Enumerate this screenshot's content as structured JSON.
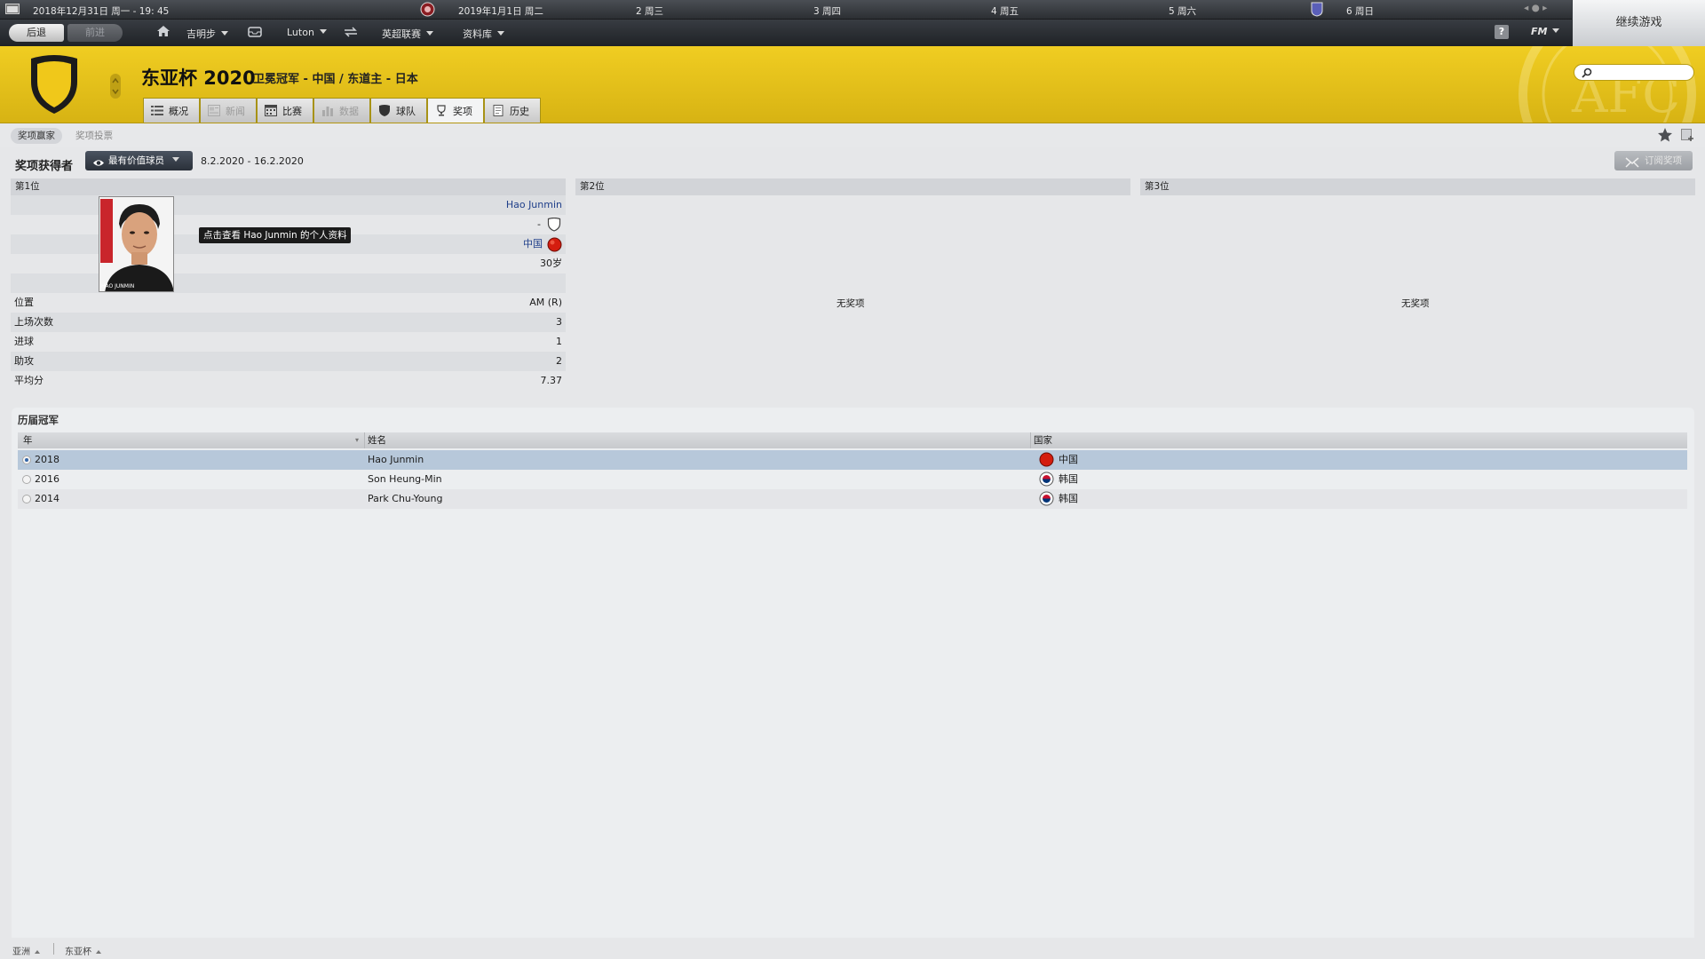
{
  "calendar": {
    "current_date": "2018年12月31日 周一 - 19: 45",
    "days": [
      "2019年1月1日 周二",
      "2 周三",
      "3 周四",
      "4 周五",
      "5 周六",
      "6 周日"
    ]
  },
  "nav": {
    "back": "后退",
    "forward": "前进",
    "manager": "吉明步",
    "club": "Luton",
    "league": "英超联赛",
    "database": "资料库",
    "help": "?",
    "fm_menu": "FM",
    "continue": "继续游戏"
  },
  "header": {
    "title": "东亚杯 2020",
    "subtitle": "卫冕冠军 - 中国 / 东道主 - 日本",
    "tabs": [
      {
        "label": "概况",
        "icon": "list-icon",
        "state": "normal"
      },
      {
        "label": "新闻",
        "icon": "newspaper-icon",
        "state": "disabled"
      },
      {
        "label": "比赛",
        "icon": "calendar-icon",
        "state": "normal"
      },
      {
        "label": "数据",
        "icon": "stats-icon",
        "state": "disabled"
      },
      {
        "label": "球队",
        "icon": "shield-icon",
        "state": "normal"
      },
      {
        "label": "奖项",
        "icon": "trophy-icon",
        "state": "active"
      },
      {
        "label": "历史",
        "icon": "book-icon",
        "state": "normal"
      }
    ],
    "accent": "#e6c21c"
  },
  "subnav": {
    "tabs": [
      "奖项赢家",
      "奖项投票"
    ],
    "active": 0
  },
  "award": {
    "label": "奖项获得者",
    "selected": "最有价值球员",
    "dates": "8.2.2020 - 16.2.2020",
    "subscribe": "订阅奖项"
  },
  "places": {
    "first": {
      "heading": "第1位",
      "player_name": "Hao Junmin",
      "club": "-",
      "nation": "中国",
      "age": "30岁",
      "photo_caption": "HAO JUNMIN",
      "tooltip": "点击查看 Hao Junmin 的个人资料",
      "stats": [
        {
          "label": "位置",
          "value": "AM (R)"
        },
        {
          "label": "上场次数",
          "value": "3"
        },
        {
          "label": "进球",
          "value": "1"
        },
        {
          "label": "助攻",
          "value": "2"
        },
        {
          "label": "平均分",
          "value": "7.37"
        }
      ]
    },
    "second": {
      "heading": "第2位",
      "empty": "无奖项"
    },
    "third": {
      "heading": "第3位",
      "empty": "无奖项"
    }
  },
  "history": {
    "title": "历届冠军",
    "columns": [
      "年",
      "姓名",
      "国家"
    ],
    "rows": [
      {
        "year": "2018",
        "name": "Hao Junmin",
        "nation": "中国",
        "flag": "china-flag-icon",
        "selected": true
      },
      {
        "year": "2016",
        "name": "Son Heung-Min",
        "nation": "韩国",
        "flag": "korea-flag-icon",
        "selected": false
      },
      {
        "year": "2014",
        "name": "Park Chu-Young",
        "nation": "韩国",
        "flag": "korea-flag-icon",
        "selected": false
      }
    ]
  },
  "statusbar": {
    "crumbs": [
      "亚洲",
      "东亚杯"
    ]
  }
}
